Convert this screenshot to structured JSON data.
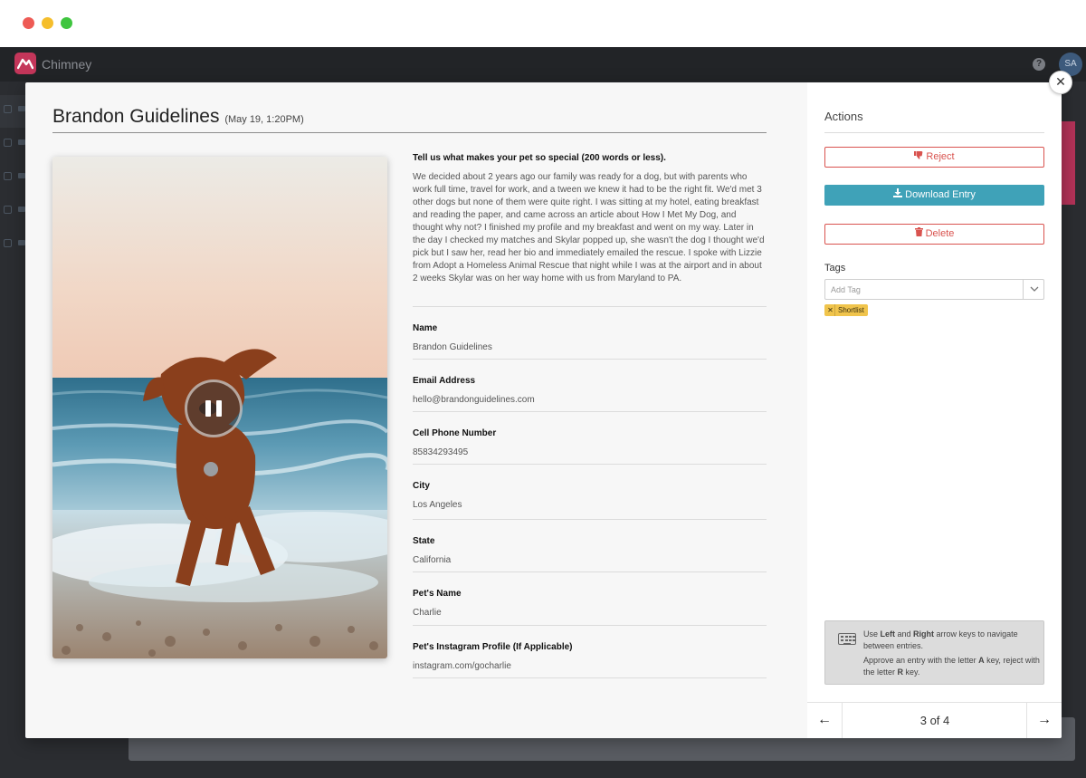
{
  "app": {
    "brand": "Chimney",
    "avatar_initials": "SA",
    "help_icon": "?"
  },
  "entry": {
    "name": "Brandon Guidelines",
    "date": "(May 19, 1:20PM)",
    "essay_question": "Tell us what makes your pet so special (200 words or less).",
    "essay_answer": "We decided about 2 years ago our family was ready for a dog, but with parents who work full time, travel for work, and a tween we knew it had to be the right fit. We'd met 3 other dogs but none of them were quite right. I was sitting at my hotel, eating breakfast and reading the paper, and came across an article about How I Met My Dog, and thought why not? I finished my profile and my breakfast and went on my way. Later in the day I checked my matches and Skylar popped up, she wasn't the dog I thought we'd pick but I saw her, read her bio and immediately emailed the rescue. I spoke with Lizzie from Adopt a Homeless Animal Rescue that night while I was at the airport and in about 2 weeks Skylar was on her way home with us from Maryland to PA.",
    "fields": [
      {
        "label": "Name",
        "value": "Brandon Guidelines"
      },
      {
        "label": "Email Address",
        "value": "hello@brandonguidelines.com"
      },
      {
        "label": "Cell Phone Number",
        "value": "85834293495"
      },
      {
        "label": "City",
        "value": "Los Angeles"
      },
      {
        "label": "State",
        "value": "California"
      },
      {
        "label": "Pet's Name",
        "value": "Charlie"
      },
      {
        "label": "Pet's Instagram Profile (If Applicable)",
        "value": "instagram.com/gocharlie"
      }
    ]
  },
  "actions": {
    "title": "Actions",
    "reject_label": "Reject",
    "download_label": "Download Entry",
    "delete_label": "Delete",
    "tags_label": "Tags",
    "tag_placeholder": "Add Tag",
    "tags": [
      "Shortlist"
    ]
  },
  "hint": {
    "line1_pre": "Use ",
    "line1_left": "Left",
    "line1_and": " and ",
    "line1_right": "Right",
    "line1_post": " arrow keys to navigate between entries.",
    "line2_pre": "Approve an entry with the letter ",
    "line2_a": "A",
    "line2_mid": " key, reject with the letter ",
    "line2_r": "R",
    "line2_post": " key."
  },
  "pager": {
    "label": "3 of 4",
    "prev_icon": "←",
    "next_icon": "→"
  },
  "colors": {
    "reject": "#d9534f",
    "download": "#3fa2b8",
    "tag": "#f0c44c",
    "brand": "#c4365a"
  },
  "icons": {
    "reject": "thumbs-down-icon",
    "download": "download-icon",
    "delete": "trash-icon",
    "close": "close-icon",
    "keyboard": "keyboard-icon",
    "pause": "pause-icon"
  }
}
